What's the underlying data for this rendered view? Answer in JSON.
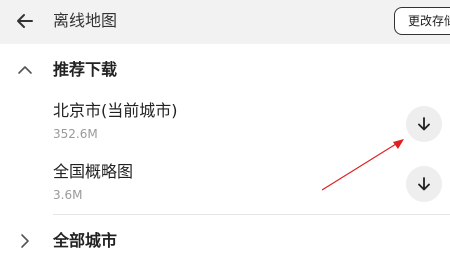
{
  "header": {
    "title": "离线地图",
    "change_storage_label": "更改存储",
    "back_icon": "arrow-left-icon"
  },
  "recommended": {
    "label": "推荐下载",
    "expanded": true,
    "items": [
      {
        "name": "北京市(当前城市)",
        "size": "352.6M"
      },
      {
        "name": "全国概略图",
        "size": "3.6M"
      }
    ]
  },
  "all_cities": {
    "label": "全部城市",
    "expanded": false
  },
  "colors": {
    "header_bg": "#f2f2f2",
    "annotation_arrow": "#e02020",
    "secondary_text": "#9a9a9a"
  }
}
